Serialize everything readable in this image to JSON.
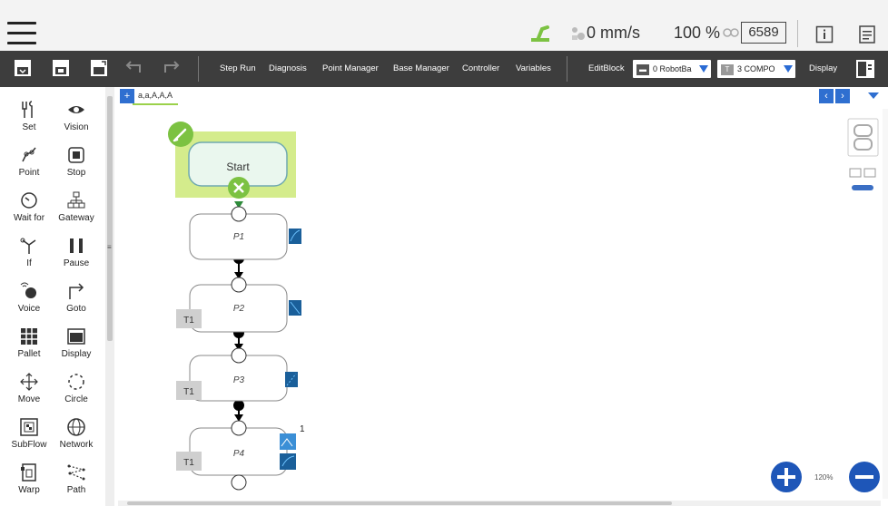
{
  "status": {
    "speed": "0 mm/s",
    "percent": "100 %",
    "code": "6589"
  },
  "toolbar": {
    "step_run": "Step Run",
    "diagnosis": "Diagnosis",
    "point_manager": "Point Manager",
    "base_manager": "Base Manager",
    "controller": "Controller",
    "variables": "Variables",
    "editblock": "EditBlock",
    "base_dropdown": "0 RobotBa",
    "tool_dropdown": "3 COMPO",
    "tool_badge": "T",
    "display": "Display"
  },
  "palette": {
    "items": [
      {
        "label": "Set",
        "icon": "set-icon"
      },
      {
        "label": "Vision",
        "icon": "vision-icon"
      },
      {
        "label": "Point",
        "icon": "point-icon"
      },
      {
        "label": "Stop",
        "icon": "stop-icon"
      },
      {
        "label": "Wait for",
        "icon": "wait-for-icon"
      },
      {
        "label": "Gateway",
        "icon": "gateway-icon"
      },
      {
        "label": "If",
        "icon": "if-icon"
      },
      {
        "label": "Pause",
        "icon": "pause-icon"
      },
      {
        "label": "Voice",
        "icon": "voice-icon"
      },
      {
        "label": "Goto",
        "icon": "goto-icon"
      },
      {
        "label": "Pallet",
        "icon": "pallet-icon"
      },
      {
        "label": "Display",
        "icon": "display-icon"
      },
      {
        "label": "Move",
        "icon": "move-icon"
      },
      {
        "label": "Circle",
        "icon": "circle-icon"
      },
      {
        "label": "SubFlow",
        "icon": "subflow-icon"
      },
      {
        "label": "Network",
        "icon": "network-icon"
      },
      {
        "label": "Warp",
        "icon": "warp-icon"
      },
      {
        "label": "Path",
        "icon": "path-icon"
      }
    ]
  },
  "flow": {
    "tab_name": "a,a,A,A,A",
    "start_label": "Start",
    "nodes": [
      {
        "label": "P1",
        "tool": ""
      },
      {
        "label": "P2",
        "tool": "T1"
      },
      {
        "label": "P3",
        "tool": "T1"
      },
      {
        "label": "P4",
        "tool": "T1",
        "badge": "1"
      }
    ]
  },
  "zoom": "120%",
  "colors": {
    "toolbar_bg": "#3d3d3d",
    "accent_green": "#7cc242",
    "start_highlight": "#d4ec8c",
    "node_blue": "#1a5f9a",
    "nav_blue": "#2f6fd0"
  }
}
